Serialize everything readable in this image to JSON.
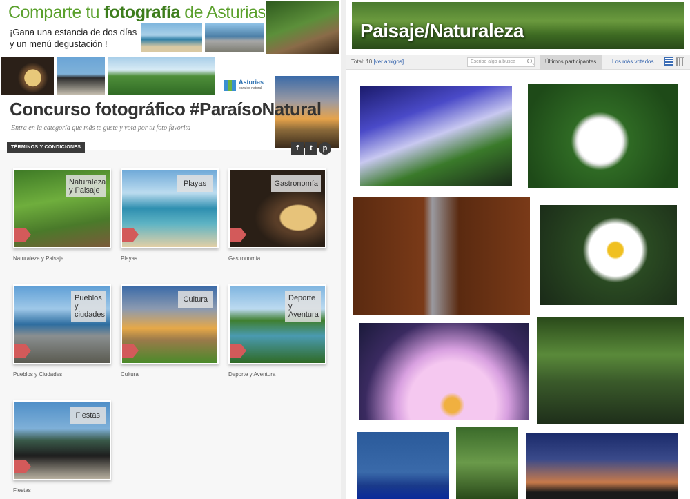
{
  "banner": {
    "title_pre": "Comparte tu ",
    "title_bold": "fotografía",
    "title_post": " de Asturias",
    "subtitle": "¡Gana una estancia de dos días y un menú degustación !",
    "logo_text": "Asturias",
    "logo_sub": "paraíso natural",
    "contest_title": "Concurso fotográfico #ParaísoNatural",
    "contest_subtitle": "Entra en la categoría que más te guste y vota por tu foto favorita",
    "terms_label": "TÉRMINOS Y CONDICIONES",
    "social": [
      "f",
      "t",
      "p"
    ]
  },
  "categories": [
    {
      "label": "Naturaleza y Paisaje",
      "caption": "Naturaleza y Paisaje"
    },
    {
      "label": "Playas",
      "caption": "Playas"
    },
    {
      "label": "Gastronomía",
      "caption": "Gastronomía"
    },
    {
      "label": "Pueblos y ciudades",
      "caption": "Pueblos y Ciudades"
    },
    {
      "label": "Cultura",
      "caption": "Cultura"
    },
    {
      "label": "Deporte y Aventura",
      "caption": "Deporte y Aventura"
    },
    {
      "label": "Fiestas",
      "caption": "Fiestas"
    }
  ],
  "gallery": {
    "header_title": "Paisaje/Naturaleza",
    "total_prefix": "Total: 10",
    "see_friends": "[ver amigos]",
    "search_placeholder": "Escribe algo a busca",
    "tab_recent": "Últimos participantes",
    "tab_voted": "Los más votados"
  },
  "icons": {
    "search": "search-icon",
    "grid_view": "grid-view-icon",
    "list_view": "list-view-icon",
    "facebook": "facebook-icon",
    "twitter": "twitter-icon",
    "pinterest": "pinterest-icon",
    "flag": "bookmark-flag-icon"
  }
}
